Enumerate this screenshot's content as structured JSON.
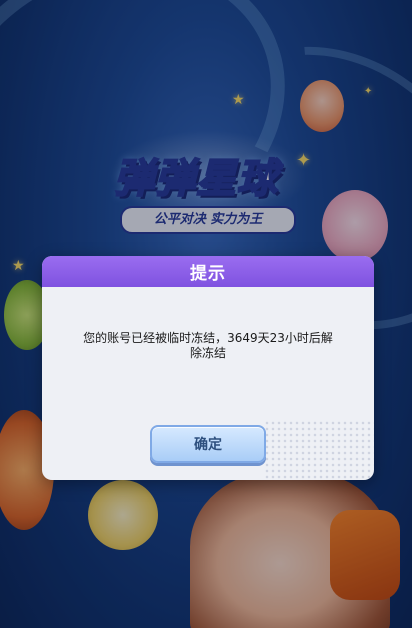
{
  "game": {
    "title": "弹弹星球",
    "slogan": "公平对决  实力为王"
  },
  "dialog": {
    "title": "提示",
    "message": "您的账号已经被临时冻结，3649天23小时后解除冻结",
    "confirm_label": "确定"
  },
  "colors": {
    "dialog_header": "#8a5de8",
    "dialog_body": "#eef0f5",
    "confirm_button": "#b8d6fa",
    "background": "#1f4f9a"
  }
}
